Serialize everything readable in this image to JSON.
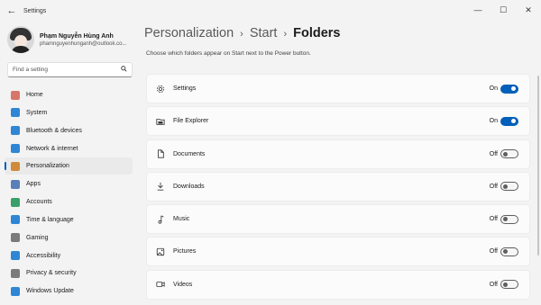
{
  "window": {
    "title": "Settings",
    "back_glyph": "←",
    "controls": [
      "—",
      "☐",
      "✕"
    ]
  },
  "profile": {
    "name": "Phạm Nguyễn Hùng Anh",
    "email": "phamnguyenhunganh@outlook.co..."
  },
  "search": {
    "placeholder": "Find a setting",
    "icon": "search-icon"
  },
  "nav": [
    {
      "label": "Home",
      "icon": "home-icon",
      "color": "#d8756a"
    },
    {
      "label": "System",
      "icon": "system-icon",
      "color": "#2f86d4"
    },
    {
      "label": "Bluetooth & devices",
      "icon": "bluetooth-icon",
      "color": "#2f86d4"
    },
    {
      "label": "Network & internet",
      "icon": "network-icon",
      "color": "#2f86d4"
    },
    {
      "label": "Personalization",
      "icon": "personalization-icon",
      "color": "#d08a3a",
      "active": true
    },
    {
      "label": "Apps",
      "icon": "apps-icon",
      "color": "#5a7fb8"
    },
    {
      "label": "Accounts",
      "icon": "accounts-icon",
      "color": "#3aa06b"
    },
    {
      "label": "Time & language",
      "icon": "time-language-icon",
      "color": "#2f86d4"
    },
    {
      "label": "Gaming",
      "icon": "gaming-icon",
      "color": "#7a7a7a"
    },
    {
      "label": "Accessibility",
      "icon": "accessibility-icon",
      "color": "#2f86d4"
    },
    {
      "label": "Privacy & security",
      "icon": "shield-icon",
      "color": "#7a7a7a"
    },
    {
      "label": "Windows Update",
      "icon": "windows-update-icon",
      "color": "#2f86d4"
    }
  ],
  "breadcrumb": [
    "Personalization",
    "Start",
    "Folders"
  ],
  "breadcrumb_sep": "›",
  "subtitle": "Choose which folders appear on Start next to the Power button.",
  "folders": [
    {
      "label": "Settings",
      "icon": "gear-icon",
      "state": "On",
      "on": true
    },
    {
      "label": "File Explorer",
      "icon": "file-explorer-icon",
      "state": "On",
      "on": true
    },
    {
      "label": "Documents",
      "icon": "document-icon",
      "state": "Off",
      "on": false
    },
    {
      "label": "Downloads",
      "icon": "download-icon",
      "state": "Off",
      "on": false
    },
    {
      "label": "Music",
      "icon": "music-icon",
      "state": "Off",
      "on": false
    },
    {
      "label": "Pictures",
      "icon": "picture-icon",
      "state": "Off",
      "on": false
    },
    {
      "label": "Videos",
      "icon": "video-icon",
      "state": "Off",
      "on": false
    }
  ],
  "accent_color": "#005fb8"
}
